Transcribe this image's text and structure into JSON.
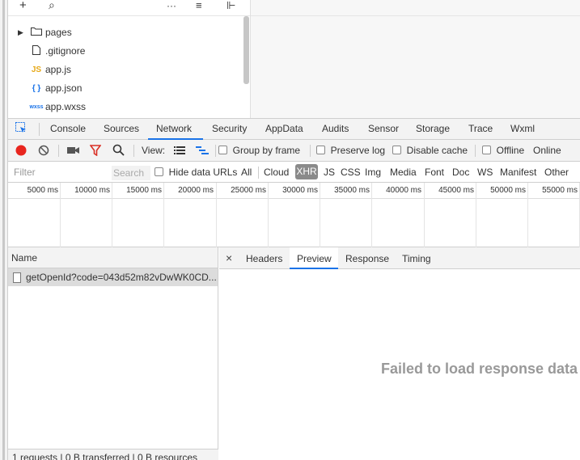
{
  "file_tree": {
    "toolbar_icons": [
      "plus-icon",
      "search-icon",
      "more-icon",
      "collapse-icon",
      "split-icon"
    ],
    "toolbar_glyphs": {
      "plus": "+",
      "search": "⌕",
      "more": "···",
      "collapse": "≡",
      "split": "⊩"
    },
    "items": [
      {
        "label": "pages",
        "icon": "folder-icon",
        "badge": ""
      },
      {
        "label": ".gitignore",
        "icon": "file-icon",
        "badge": ""
      },
      {
        "label": "app.js",
        "icon": "js-icon",
        "badge": "JS"
      },
      {
        "label": "app.json",
        "icon": "json-icon",
        "badge": "{ }"
      },
      {
        "label": "app.wxss",
        "icon": "wxss-icon",
        "badge": "wxss"
      }
    ]
  },
  "tabs": [
    "Console",
    "Sources",
    "Network",
    "Security",
    "AppData",
    "Audits",
    "Sensor",
    "Storage",
    "Trace",
    "Wxml"
  ],
  "active_tab": "Network",
  "toolbar": {
    "view_label": "View:",
    "group_by_frame": "Group by frame",
    "preserve_log": "Preserve log",
    "disable_cache": "Disable cache",
    "offline": "Offline",
    "online": "Online"
  },
  "filter": {
    "placeholder": "Filter",
    "search_placeholder": "Search",
    "hide_data_urls": "Hide data URLs",
    "types": [
      "All",
      "Cloud",
      "XHR",
      "JS",
      "CSS",
      "Img",
      "Media",
      "Font",
      "Doc",
      "WS",
      "Manifest",
      "Other"
    ],
    "active_type": "XHR"
  },
  "timeline": {
    "ticks": [
      "5000 ms",
      "10000 ms",
      "15000 ms",
      "20000 ms",
      "25000 ms",
      "30000 ms",
      "35000 ms",
      "40000 ms",
      "45000 ms",
      "50000 ms",
      "55000 ms"
    ]
  },
  "requests": {
    "header": "Name",
    "rows": [
      "getOpenId?code=043d52m82vDwWK0CD..."
    ],
    "status": "1 requests | 0 B transferred | 0 B resources"
  },
  "detail": {
    "close": "×",
    "tabs": [
      "Headers",
      "Preview",
      "Response",
      "Timing"
    ],
    "active_tab": "Preview",
    "message": "Failed to load response data"
  },
  "colors": {
    "record": "#e8251e",
    "filter_icon": "#d93025",
    "accent": "#1a73e8",
    "failed_text": "#999999"
  }
}
